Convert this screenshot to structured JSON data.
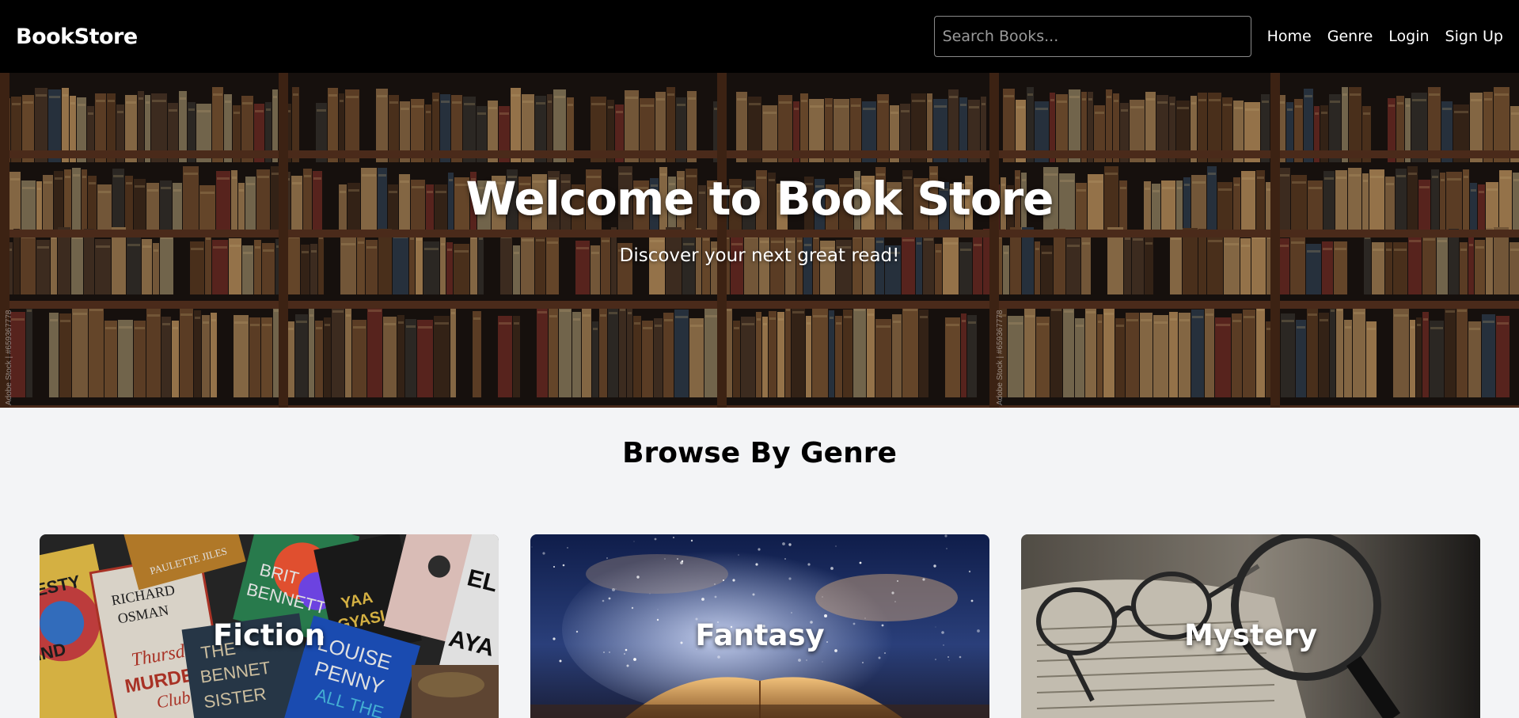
{
  "navbar": {
    "brand": "BookStore",
    "search_placeholder": "Search Books...",
    "links": [
      "Home",
      "Genre",
      "Login",
      "Sign Up"
    ]
  },
  "hero": {
    "title": "Welcome to Book Store",
    "subtitle": "Discover your next great read!",
    "watermark": "Adobe Stock | #659367778"
  },
  "genres": {
    "title": "Browse By Genre",
    "cards": [
      {
        "label": "Fiction",
        "image": "book-covers-collage"
      },
      {
        "label": "Fantasy",
        "image": "open-book-starry-sky"
      },
      {
        "label": "Mystery",
        "image": "glasses-magnifier-on-book"
      }
    ]
  },
  "colors": {
    "navbar_bg": "#000000",
    "page_bg": "#f3f4f6",
    "text_dark": "#000000",
    "text_light": "#ffffff"
  }
}
